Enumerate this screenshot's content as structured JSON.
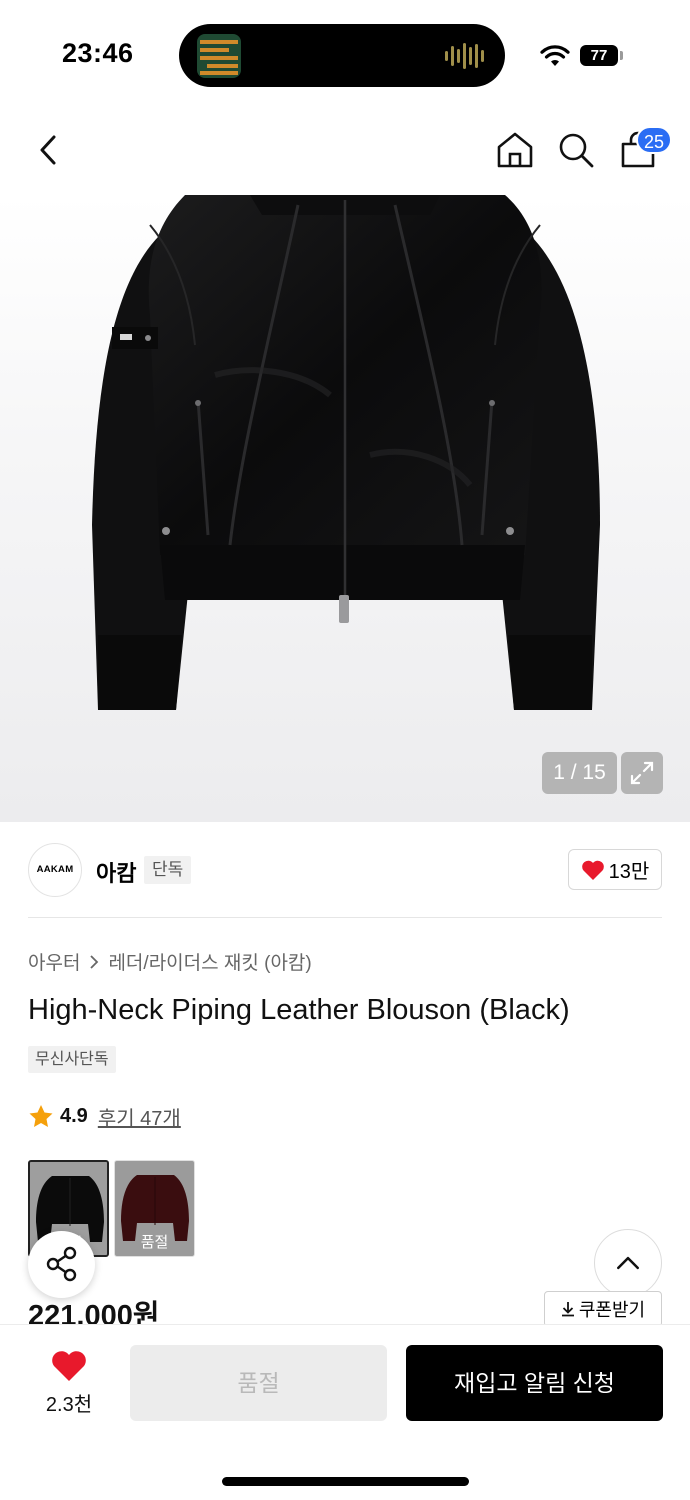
{
  "status_bar": {
    "time": "23:46",
    "battery": "77",
    "icons": [
      "now-playing-artwork",
      "audio-waveform-icon",
      "wifi-icon",
      "battery-icon"
    ]
  },
  "nav": {
    "icons": [
      "back-icon",
      "home-icon",
      "search-icon",
      "cart-icon"
    ],
    "cart_count": "25"
  },
  "gallery": {
    "counter": "1 / 15",
    "image_alt_icon": "expand-icon"
  },
  "brand": {
    "logo_text": "AAKAM",
    "name": "아캄",
    "tag": "단독",
    "likes": "13만"
  },
  "product": {
    "breadcrumb": [
      "아우터",
      "레더/라이더스 재킷 (아캄)"
    ],
    "title": "High-Neck Piping Leather Blouson (Black)",
    "tag": "무신사단독",
    "rating": "4.9",
    "reviews": "후기 47개",
    "variants": [
      {
        "color": "black",
        "sold_out": true,
        "label": "품절"
      },
      {
        "color": "burgundy",
        "sold_out": true,
        "label": "품절"
      }
    ],
    "price": "221,000원",
    "coupon": "쿠폰받기"
  },
  "bottom_bar": {
    "wish_count": "2.3천",
    "soldout_label": "품절",
    "restock_label": "재입고 알림 신청"
  },
  "colors": {
    "accent_blue": "#2a6df4",
    "heart_red": "#e8192c",
    "star_orange": "#f5a00b",
    "button_black": "#000000"
  }
}
